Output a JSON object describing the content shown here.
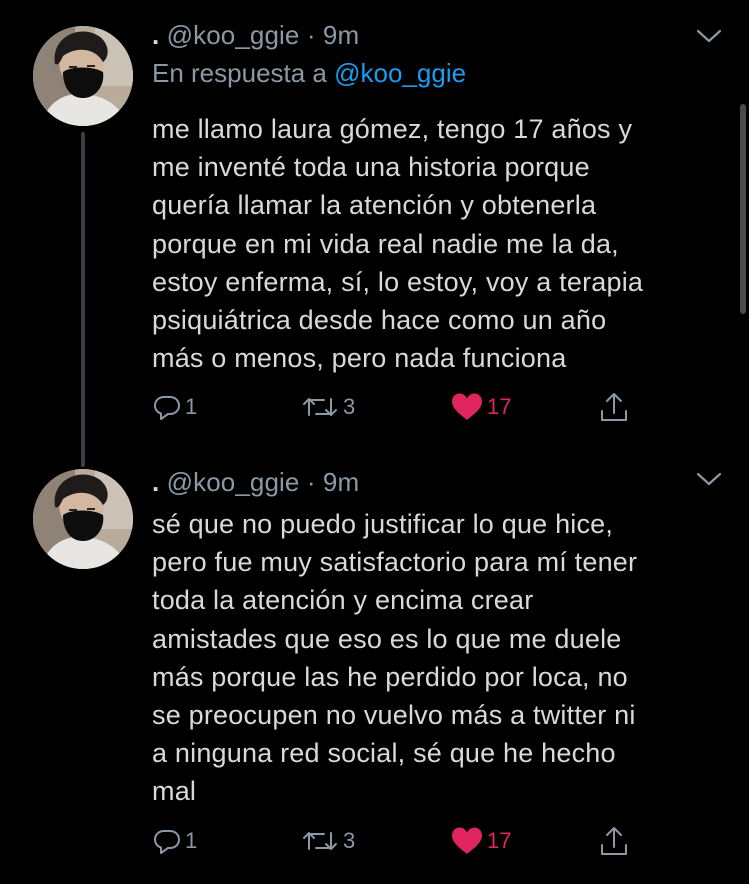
{
  "tweets": [
    {
      "display_name": ".",
      "handle": "@koo_ggie",
      "separator": "·",
      "time": "9m",
      "reply_prefix": "En respuesta a",
      "reply_handle": "@koo_ggie",
      "text_lines": [
        "me llamo laura gómez, tengo 17 años y",
        "me inventé toda una historia porque",
        "quería llamar la atención y obtenerla",
        "porque en mi vida real nadie me la da,",
        "estoy enferma, sí, lo estoy, voy a terapia",
        "psiquiátrica desde hace como un año",
        "más o menos, pero nada funciona"
      ],
      "replies": "1",
      "retweets": "3",
      "likes": "17",
      "liked": true
    },
    {
      "display_name": ".",
      "handle": "@koo_ggie",
      "separator": "·",
      "time": "9m",
      "text_lines": [
        "sé que no puedo justificar lo que hice,",
        "pero fue muy satisfactorio para mí tener",
        "toda la atención y encima crear",
        "amistades que eso es lo que me duele",
        "más porque las he perdido por loca, no",
        "se preocupen no vuelvo más a twitter ni",
        "a ninguna red social, sé que he hecho",
        "mal"
      ],
      "replies": "1",
      "retweets": "3",
      "likes": "17",
      "liked": true
    }
  ],
  "icons": {
    "reply": "reply-icon",
    "retweet": "retweet-icon",
    "like": "heart-icon",
    "share": "share-icon",
    "more": "chevron-down-icon"
  },
  "colors": {
    "background": "#000000",
    "text": "#d9d9d9",
    "secondary": "#8b98a5",
    "link": "#1d9bf0",
    "like": "#e0245e",
    "thread_line": "#3a3f44"
  }
}
